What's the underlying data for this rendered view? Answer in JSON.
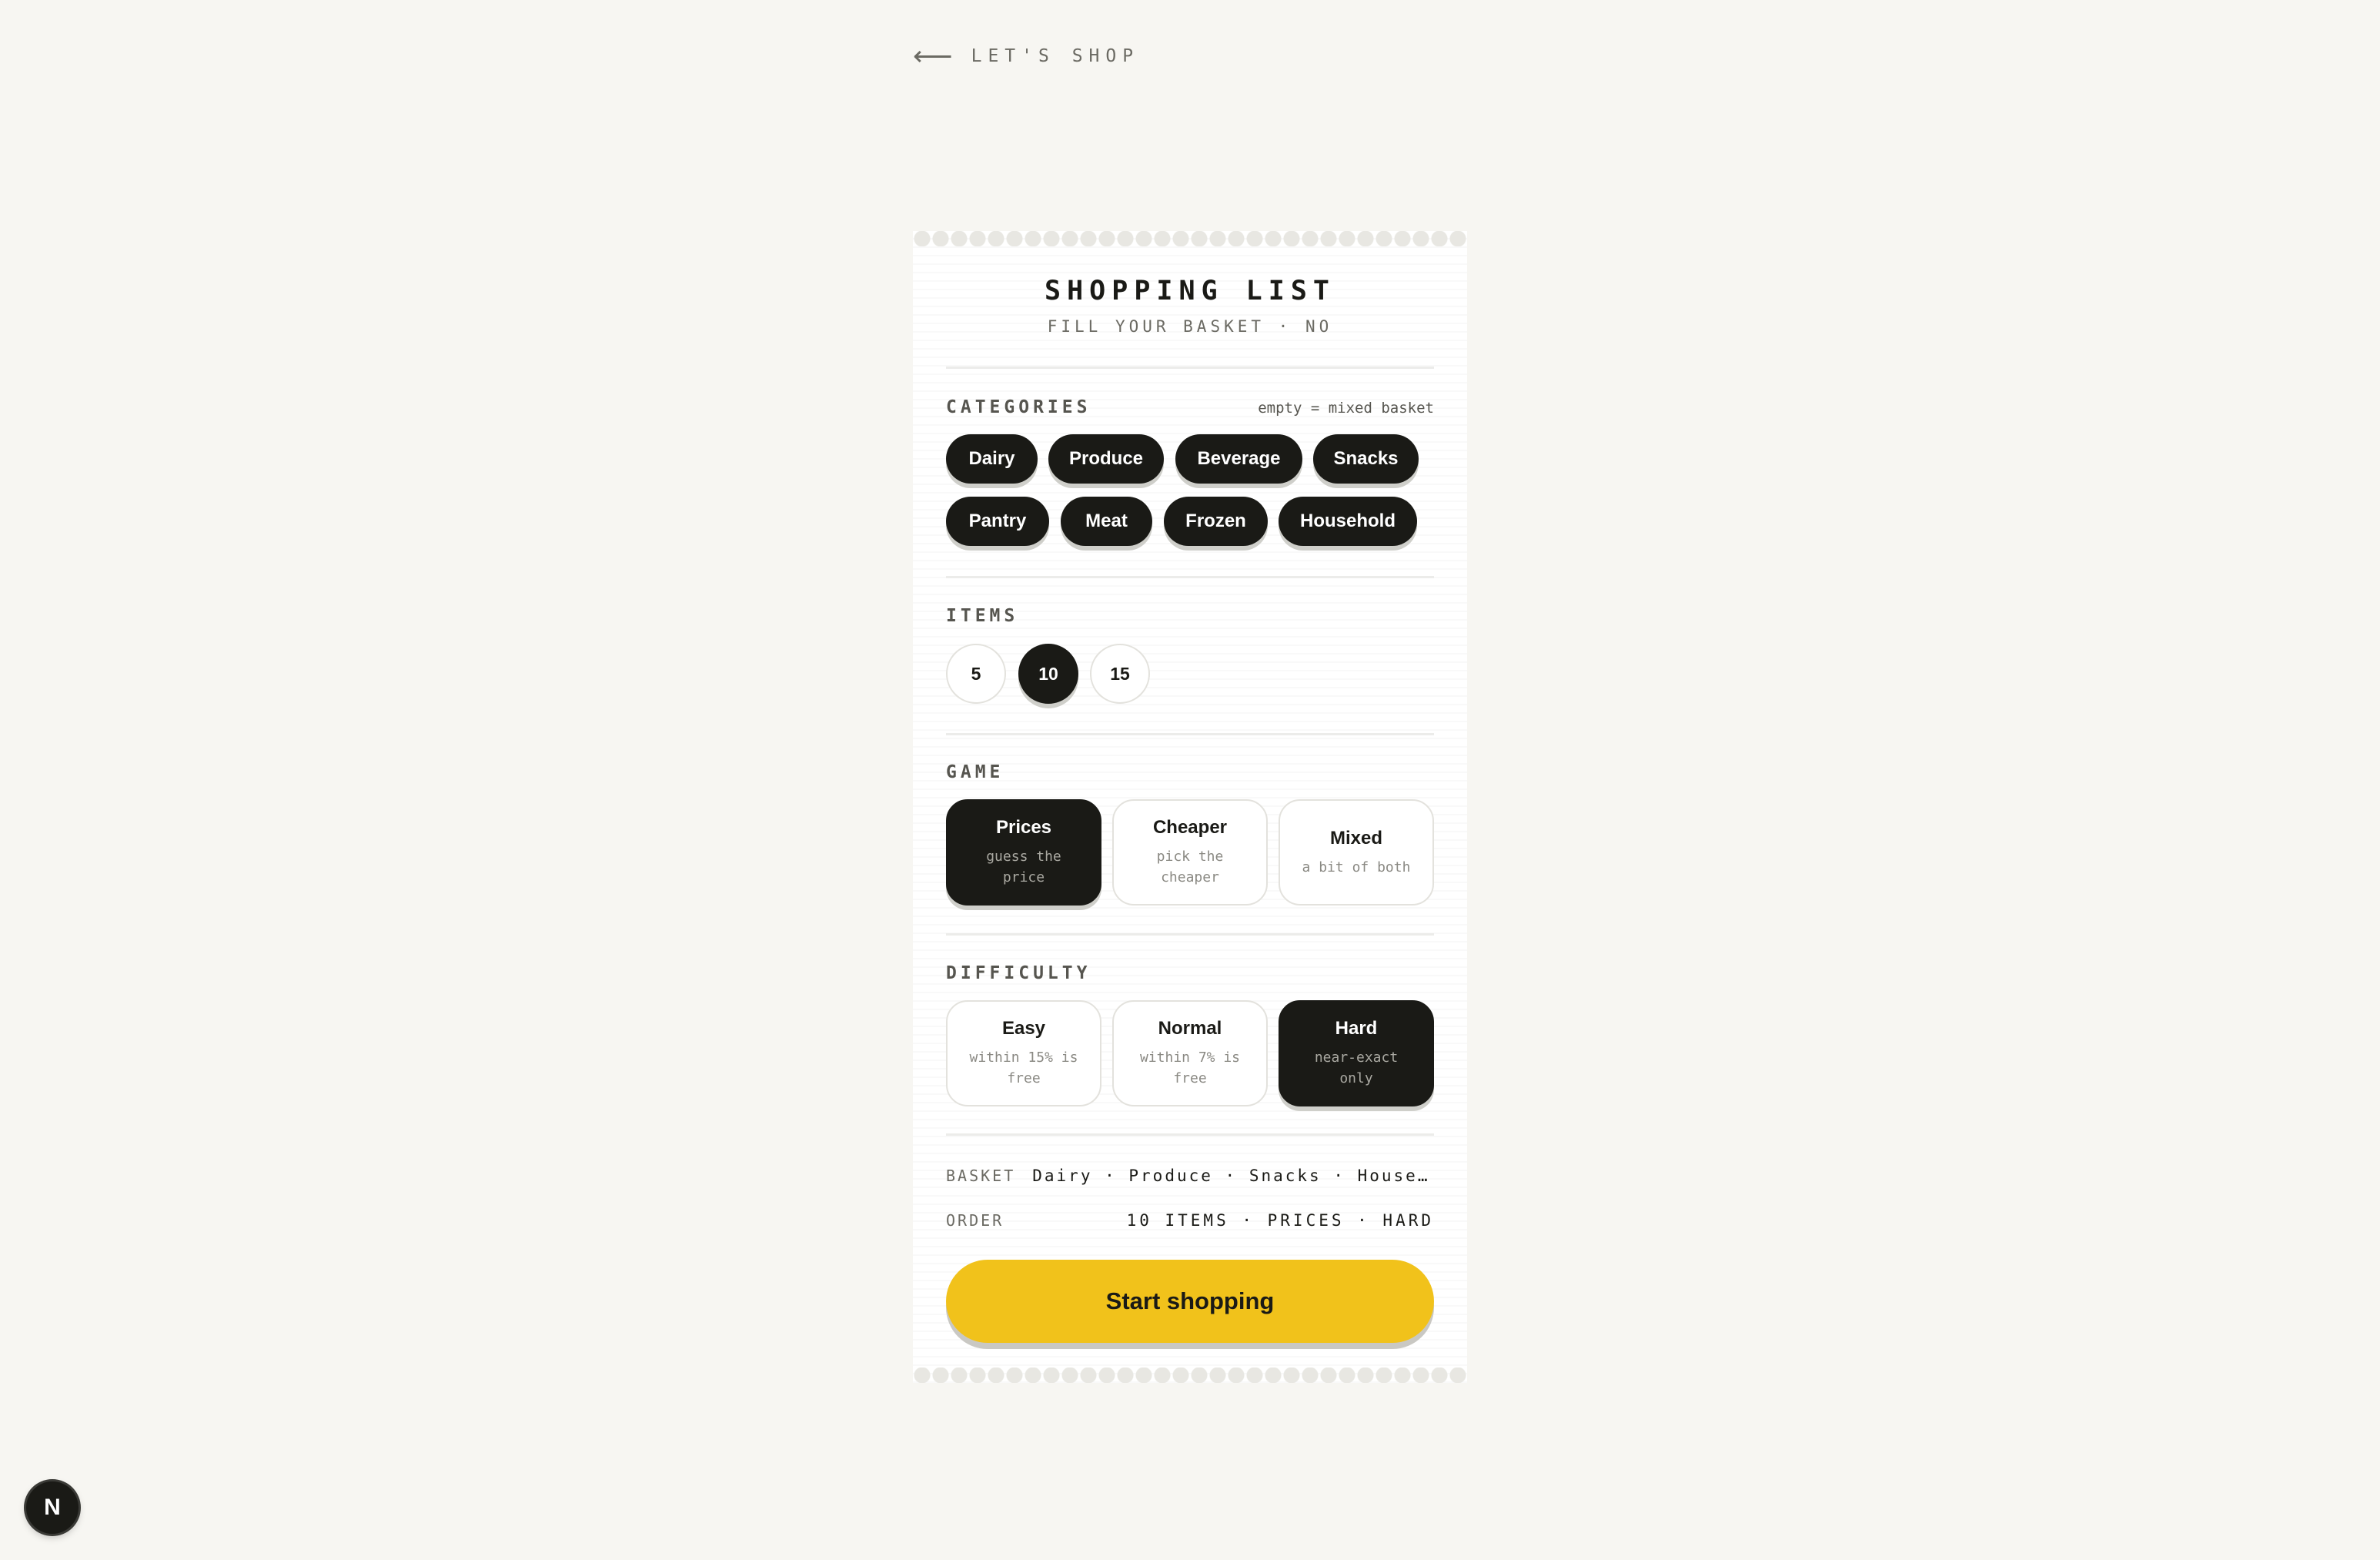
{
  "nav": {
    "back_arrow": "⟵",
    "back_label": "LET'S SHOP"
  },
  "receipt": {
    "title": "SHOPPING LIST",
    "subtitle": "FILL YOUR BASKET · NO"
  },
  "categories": {
    "label": "CATEGORIES",
    "hint": "empty = mixed basket",
    "items": [
      "Dairy",
      "Produce",
      "Beverage",
      "Snacks",
      "Pantry",
      "Meat",
      "Frozen",
      "Household"
    ],
    "selected": [
      "Dairy",
      "Produce",
      "Beverage",
      "Snacks",
      "Pantry",
      "Meat",
      "Frozen",
      "Household"
    ]
  },
  "items": {
    "label": "ITEMS",
    "options": [
      "5",
      "10",
      "15"
    ],
    "selected": "10"
  },
  "game": {
    "label": "GAME",
    "options": [
      {
        "title": "Prices",
        "sub": "guess the price"
      },
      {
        "title": "Cheaper",
        "sub": "pick the cheaper"
      },
      {
        "title": "Mixed",
        "sub": "a bit of both"
      }
    ],
    "selected": "Prices"
  },
  "difficulty": {
    "label": "DIFFICULTY",
    "options": [
      {
        "title": "Easy",
        "sub": "within 15% is free"
      },
      {
        "title": "Normal",
        "sub": "within 7% is free"
      },
      {
        "title": "Hard",
        "sub": "near-exact only"
      }
    ],
    "selected": "Hard"
  },
  "summary": {
    "basket_label": "BASKET",
    "basket_value": "Dairy · Produce · Snacks · Househo…",
    "order_label": "ORDER",
    "order_value": "10 ITEMS · PRICES · HARD"
  },
  "cta": {
    "label": "Start shopping"
  },
  "badge": {
    "letter": "N"
  },
  "colors": {
    "page_bg": "#f7f6f2",
    "ink": "#1a1a16",
    "accent_yellow": "#f1c21b",
    "muted": "#6b6a63"
  }
}
